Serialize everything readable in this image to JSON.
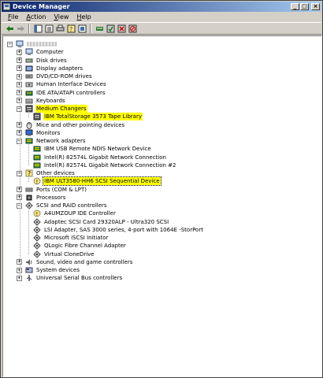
{
  "window": {
    "title": "Device Manager"
  },
  "menu": [
    {
      "label": "File",
      "mnemonic": "F",
      "rest": "ile"
    },
    {
      "label": "Action",
      "mnemonic": "A",
      "rest": "ction"
    },
    {
      "label": "View",
      "mnemonic": "V",
      "rest": "iew"
    },
    {
      "label": "Help",
      "mnemonic": "H",
      "rest": "elp"
    }
  ],
  "tree": {
    "root_label": "",
    "categories": [
      {
        "label": "Computer",
        "icon": "computer-icon",
        "expanded": false
      },
      {
        "label": "Disk drives",
        "icon": "disk-icon",
        "expanded": false
      },
      {
        "label": "Display adapters",
        "icon": "display-icon",
        "expanded": false
      },
      {
        "label": "DVD/CD-ROM drives",
        "icon": "cdrom-icon",
        "expanded": false
      },
      {
        "label": "Human Interface Devices",
        "icon": "hid-icon",
        "expanded": false
      },
      {
        "label": "IDE ATA/ATAPI controllers",
        "icon": "ide-icon",
        "expanded": false
      },
      {
        "label": "Keyboards",
        "icon": "keyboard-icon",
        "expanded": false
      },
      {
        "label": "Medium Changers",
        "icon": "changer-icon",
        "expanded": true,
        "highlight": true,
        "children": [
          {
            "label": "IBM TotalStorage 3573 Tape Library",
            "icon": "changer-icon",
            "highlight": true
          }
        ]
      },
      {
        "label": "Mice and other pointing devices",
        "icon": "mouse-icon",
        "expanded": false
      },
      {
        "label": "Monitors",
        "icon": "monitor-icon",
        "expanded": false
      },
      {
        "label": "Network adapters",
        "icon": "network-icon",
        "expanded": true,
        "children": [
          {
            "label": "IBM USB Remote NDIS Network Device",
            "icon": "network-icon"
          },
          {
            "label": "Intel(R) 82574L Gigabit Network Connection",
            "icon": "network-icon"
          },
          {
            "label": "Intel(R) 82574L Gigabit Network Connection #2",
            "icon": "network-icon"
          }
        ]
      },
      {
        "label": "Other devices",
        "icon": "unknown-device-icon",
        "expanded": true,
        "children": [
          {
            "label": "IBM ULT3580-HH6 SCSI Sequential Device",
            "icon": "warning-device-icon",
            "highlight": true,
            "selected": true
          }
        ]
      },
      {
        "label": "Ports (COM & LPT)",
        "icon": "port-icon",
        "expanded": false
      },
      {
        "label": "Processors",
        "icon": "processor-icon",
        "expanded": false
      },
      {
        "label": "SCSI and RAID controllers",
        "icon": "scsi-icon",
        "expanded": true,
        "children": [
          {
            "label": "A4UMZOUP IDE Controller",
            "icon": "warning-device-icon"
          },
          {
            "label": "Adaptec SCSI Card 29320ALP - Ultra320 SCSI",
            "icon": "scsi-icon"
          },
          {
            "label": "LSI Adapter, SAS 3000 series, 4-port with 1064E -StorPort",
            "icon": "scsi-icon"
          },
          {
            "label": "Microsoft iSCSI Initiator",
            "icon": "scsi-icon"
          },
          {
            "label": "QLogic Fibre Channel Adapter",
            "icon": "scsi-icon"
          },
          {
            "label": "Virtual CloneDrive",
            "icon": "scsi-icon"
          }
        ]
      },
      {
        "label": "Sound, video and game controllers",
        "icon": "sound-icon",
        "expanded": false
      },
      {
        "label": "System devices",
        "icon": "system-icon",
        "expanded": false
      },
      {
        "label": "Universal Serial Bus controllers",
        "icon": "usb-icon",
        "expanded": false
      }
    ]
  }
}
